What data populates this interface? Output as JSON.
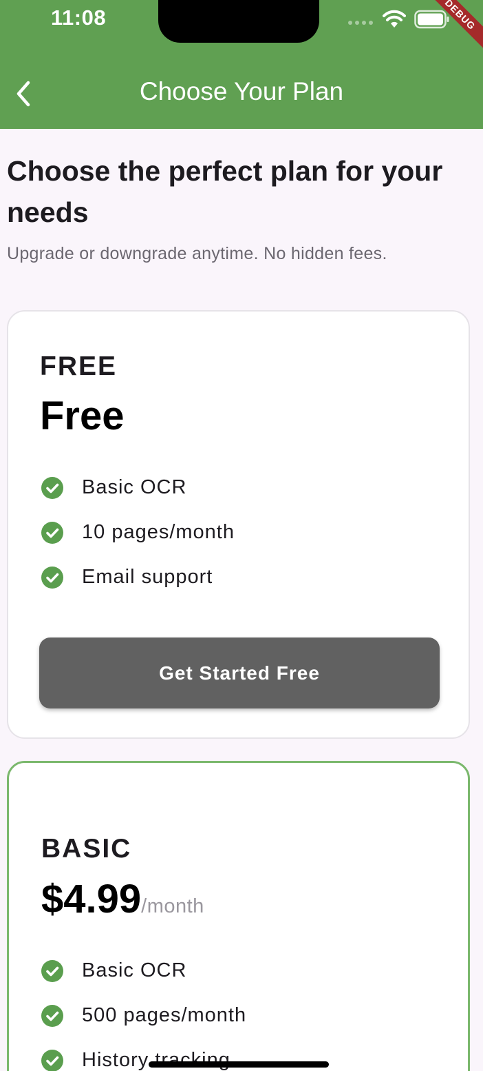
{
  "status_bar": {
    "time": "11:08",
    "debug_label": "DEBUG"
  },
  "app_bar": {
    "title": "Choose Your Plan",
    "back_icon": "chevron-left-icon",
    "color": "#60a052"
  },
  "header": {
    "title": "Choose the perfect plan for your needs",
    "subtitle": "Upgrade or downgrade anytime. No hidden fees."
  },
  "plans": [
    {
      "label": "FREE",
      "price": "Free",
      "unit": "",
      "features": [
        "Basic OCR",
        "10 pages/month",
        "Email support"
      ],
      "button_label": "Get Started Free"
    },
    {
      "label": "BASIC",
      "price": "$4.99",
      "unit": "/month",
      "features": [
        "Basic OCR",
        "500 pages/month",
        "History tracking"
      ]
    }
  ],
  "colors": {
    "accent": "#60a052",
    "check": "#5a9e4e",
    "button": "#616161",
    "highlight_border": "#7bb86d"
  }
}
